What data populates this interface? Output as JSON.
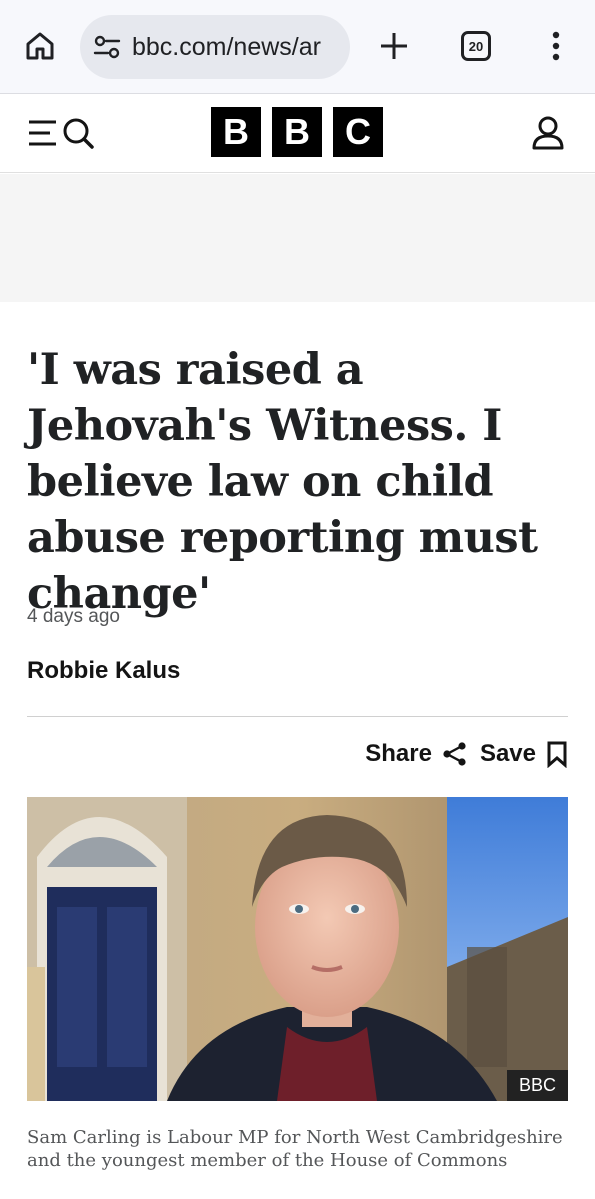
{
  "browser": {
    "url": "bbc.com/news/ar",
    "tab_count": "20",
    "icons": {
      "home": "home-icon",
      "site_settings": "tune-icon",
      "new_tab": "plus-icon",
      "menu": "more-vert-icon"
    }
  },
  "site": {
    "logo_letters": [
      "B",
      "B",
      "C"
    ],
    "icons": {
      "nav": "menu-search-icon",
      "account": "user-icon"
    }
  },
  "article": {
    "headline": "'I was raised a Jehovah's Witness. I believe law on child abuse reporting must change'",
    "timestamp": "4 days ago",
    "author": "Robbie Kalus",
    "share_label": "Share",
    "save_label": "Save",
    "image_credit": "BBC",
    "caption": "Sam Carling is Labour MP for North West Cambridgeshire and the youngest member of the House of Commons"
  },
  "colors": {
    "brand": "#000000",
    "text": "#141414",
    "muted": "#545658"
  }
}
